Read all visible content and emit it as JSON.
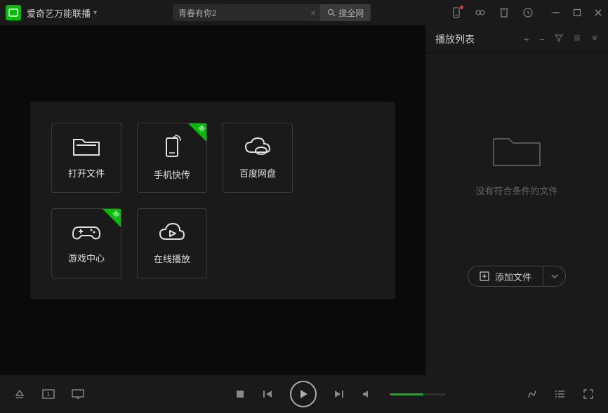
{
  "app": {
    "title": "爱奇艺万能联播"
  },
  "search": {
    "value": "青春有你2",
    "button_label": "搜全网"
  },
  "cards": [
    {
      "label": "打开文件"
    },
    {
      "label": "手机快传"
    },
    {
      "label": "百度网盘"
    },
    {
      "label": "游戏中心"
    },
    {
      "label": "在线播放"
    }
  ],
  "sidebar": {
    "title": "播放列表",
    "empty_text": "没有符合条件的文件",
    "add_file_label": "添加文件"
  }
}
